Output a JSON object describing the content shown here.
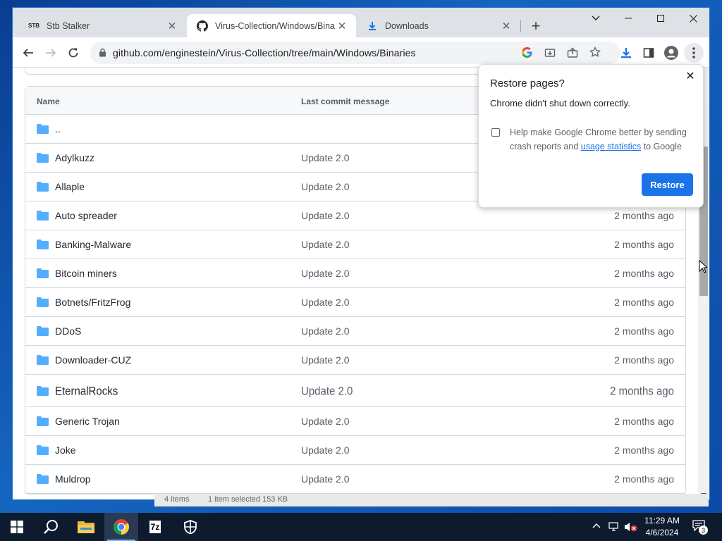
{
  "browser": {
    "tabs": [
      {
        "title": "Stb Stalker",
        "favicon": "stb-icon"
      },
      {
        "title": "Virus-Collection/Windows/Binari",
        "favicon": "github-icon"
      },
      {
        "title": "Downloads",
        "favicon": "download-icon"
      }
    ],
    "url": "github.com/enginestein/Virus-Collection/tree/main/Windows/Binaries",
    "download_accent": "#1a73e8"
  },
  "table": {
    "headers": {
      "name": "Name",
      "message": "Last commit message"
    },
    "parent": "..",
    "rows": [
      {
        "name": "Adylkuzz",
        "message": "Update 2.0",
        "age": ""
      },
      {
        "name": "Allaple",
        "message": "Update 2.0",
        "age": ""
      },
      {
        "name": "Auto spreader",
        "message": "Update 2.0",
        "age": "2 months ago"
      },
      {
        "name": "Banking-Malware",
        "message": "Update 2.0",
        "age": "2 months ago"
      },
      {
        "name": "Bitcoin miners",
        "message": "Update 2.0",
        "age": "2 months ago"
      },
      {
        "name": "Botnets/FritzFrog",
        "message": "Update 2.0",
        "age": "2 months ago"
      },
      {
        "name": "DDoS",
        "message": "Update 2.0",
        "age": "2 months ago"
      },
      {
        "name": "Downloader-CUZ",
        "message": "Update 2.0",
        "age": "2 months ago"
      },
      {
        "name": "EternalRocks",
        "message": "Update 2.0",
        "age": "2 months ago"
      },
      {
        "name": "Generic Trojan",
        "message": "Update 2.0",
        "age": "2 months ago"
      },
      {
        "name": "Joke",
        "message": "Update 2.0",
        "age": "2 months ago"
      },
      {
        "name": "Muldrop",
        "message": "Update 2.0",
        "age": "2 months ago"
      }
    ]
  },
  "popup": {
    "title": "Restore pages?",
    "subtitle": "Chrome didn't shut down correctly.",
    "checkbox_text_a": "Help make Google Chrome better by sending crash reports and ",
    "checkbox_link": "usage statistics",
    "checkbox_text_b": " to Google",
    "button": "Restore"
  },
  "behind_window": {
    "items": "4 items",
    "selected": "1 item selected  153 KB"
  },
  "taskbar": {
    "time": "11:29 AM",
    "date": "4/6/2024",
    "notifications": "3"
  },
  "colors": {
    "folder": "#54aeff",
    "primary": "#1a73e8"
  }
}
